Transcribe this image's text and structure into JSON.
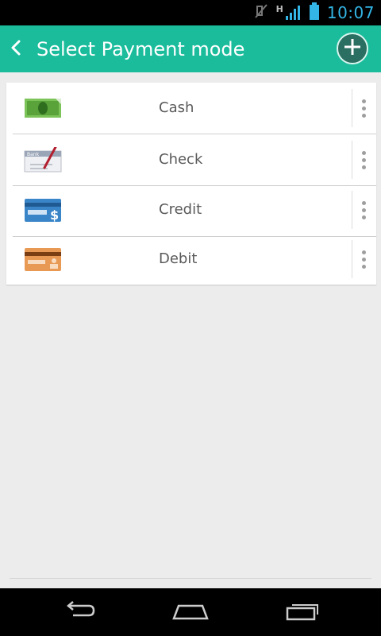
{
  "status_bar": {
    "time": "10:07",
    "network_label": "H",
    "icons": [
      "mute-icon",
      "signal-icon",
      "battery-icon"
    ],
    "accent": "#33b5e5"
  },
  "app_bar": {
    "title": "Select Payment mode",
    "back_icon": "chevron-left-icon",
    "add_icon": "add-circle-icon",
    "color": "#1abc9c"
  },
  "payment_modes": [
    {
      "label": "Cash",
      "icon": "cash-icon"
    },
    {
      "label": "Check",
      "icon": "check-icon"
    },
    {
      "label": "Credit",
      "icon": "credit-card-icon"
    },
    {
      "label": "Debit",
      "icon": "debit-card-icon"
    }
  ],
  "check_icon_text": "Bank",
  "nav_bar": {
    "icons": [
      "back-icon",
      "home-icon",
      "recent-apps-icon"
    ]
  }
}
